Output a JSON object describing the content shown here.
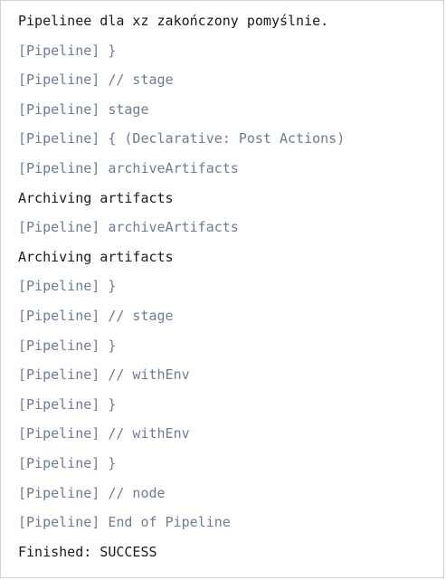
{
  "console": {
    "lines": [
      {
        "text": "Pipelinee dla xz zakończony pomyślnie.",
        "kind": "output"
      },
      {
        "text": "[Pipeline] }",
        "kind": "pipeline"
      },
      {
        "text": "[Pipeline] // stage",
        "kind": "pipeline"
      },
      {
        "text": "[Pipeline] stage",
        "kind": "pipeline"
      },
      {
        "text": "[Pipeline] { (Declarative: Post Actions)",
        "kind": "pipeline"
      },
      {
        "text": "[Pipeline] archiveArtifacts",
        "kind": "pipeline"
      },
      {
        "text": "Archiving artifacts",
        "kind": "output"
      },
      {
        "text": "[Pipeline] archiveArtifacts",
        "kind": "pipeline"
      },
      {
        "text": "Archiving artifacts",
        "kind": "output"
      },
      {
        "text": "[Pipeline] }",
        "kind": "pipeline"
      },
      {
        "text": "[Pipeline] // stage",
        "kind": "pipeline"
      },
      {
        "text": "[Pipeline] }",
        "kind": "pipeline"
      },
      {
        "text": "[Pipeline] // withEnv",
        "kind": "pipeline"
      },
      {
        "text": "[Pipeline] }",
        "kind": "pipeline"
      },
      {
        "text": "[Pipeline] // withEnv",
        "kind": "pipeline"
      },
      {
        "text": "[Pipeline] }",
        "kind": "pipeline"
      },
      {
        "text": "[Pipeline] // node",
        "kind": "pipeline"
      },
      {
        "text": "[Pipeline] End of Pipeline",
        "kind": "pipeline"
      },
      {
        "text": "Finished: SUCCESS",
        "kind": "output"
      }
    ]
  },
  "colors": {
    "pipeline_text": "#6b7c94",
    "output_text": "#1a1a1a",
    "border": "#d2d2d2"
  }
}
